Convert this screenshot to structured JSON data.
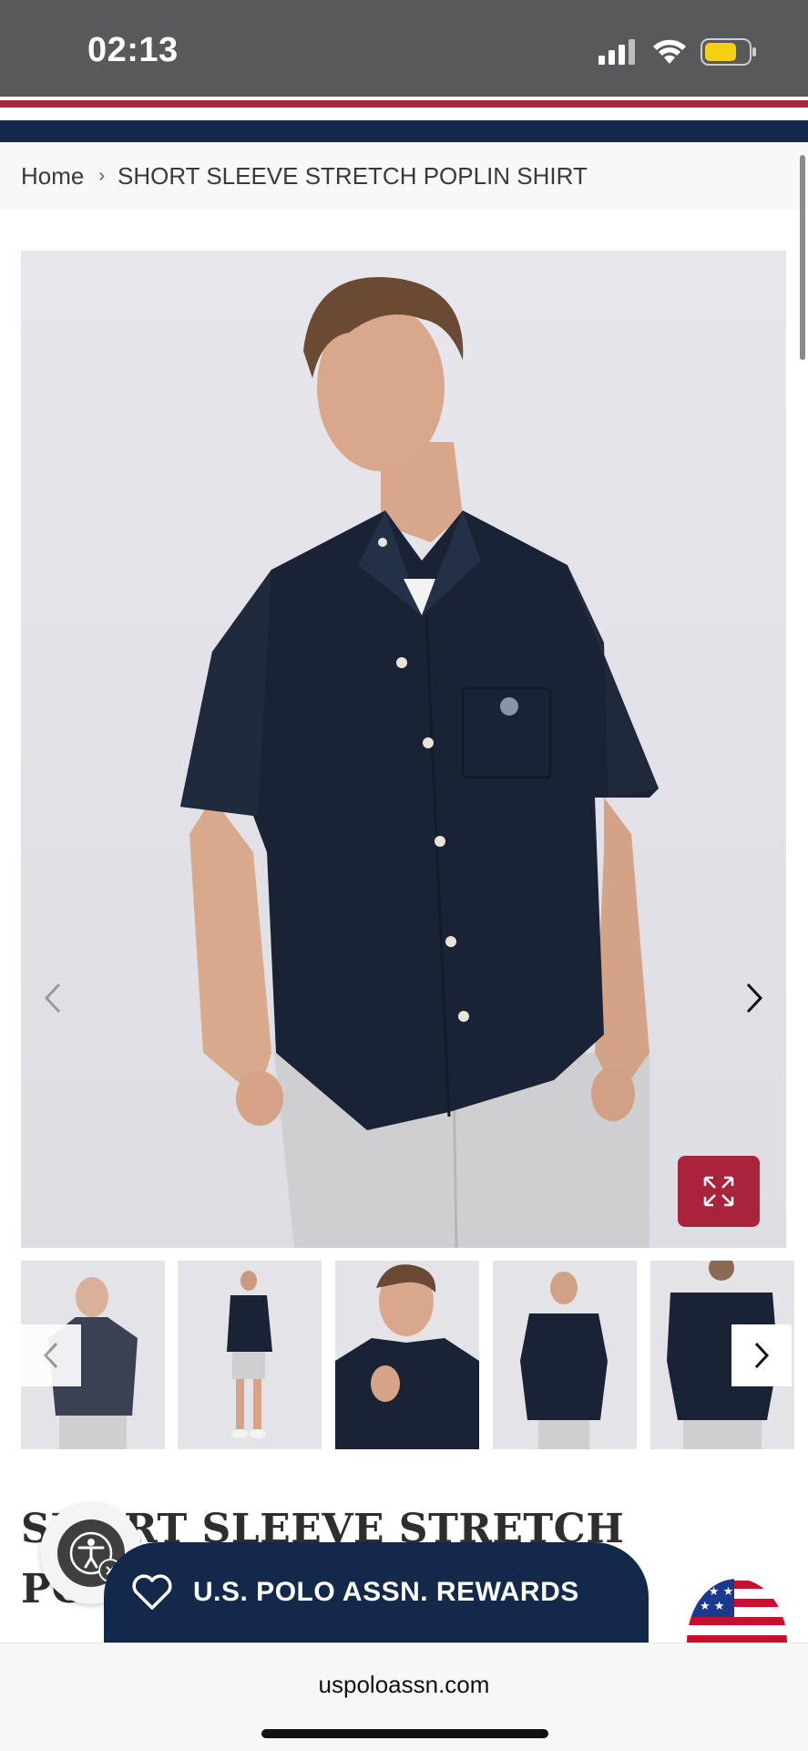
{
  "status_bar": {
    "time": "02:13",
    "icons": [
      "signal-icon",
      "wifi-icon",
      "battery-icon"
    ],
    "battery_color": "#f5cf12"
  },
  "brand_colors": {
    "navy": "#13294b",
    "red": "#a8233b"
  },
  "breadcrumb": {
    "home": "Home",
    "separator": "›",
    "current": "SHORT SLEEVE STRETCH POPLIN SHIRT"
  },
  "gallery": {
    "hero_alt": "Model wearing navy short sleeve stretch poplin shirt",
    "prev_icon": "chevron-left-icon",
    "next_icon": "chevron-right-icon",
    "zoom_icon": "expand-icon",
    "thumbnails": [
      {
        "name": "thumb-front-closeup"
      },
      {
        "name": "thumb-full-body"
      },
      {
        "name": "thumb-detail-closeup"
      },
      {
        "name": "thumb-front"
      },
      {
        "name": "thumb-back"
      }
    ]
  },
  "product": {
    "title": "SHORT SLEEVE STRETCH POPLIN SHIRT"
  },
  "rewards": {
    "icon": "heart-icon",
    "label": "U.S. POLO ASSN. REWARDS"
  },
  "accessibility": {
    "icon": "accessibility-icon"
  },
  "browser": {
    "url": "uspoloassn.com"
  }
}
